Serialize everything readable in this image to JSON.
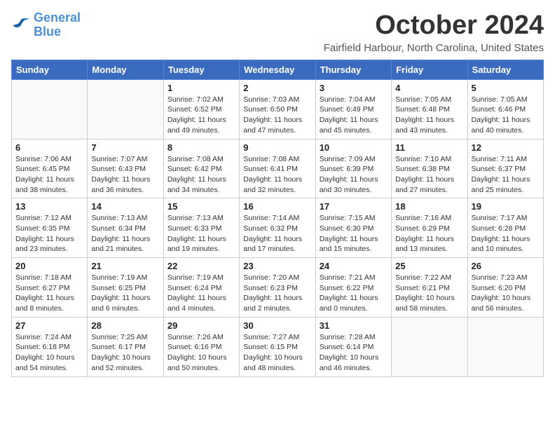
{
  "logo": {
    "general": "General",
    "blue": "Blue"
  },
  "title": "October 2024",
  "location": "Fairfield Harbour, North Carolina, United States",
  "days_of_week": [
    "Sunday",
    "Monday",
    "Tuesday",
    "Wednesday",
    "Thursday",
    "Friday",
    "Saturday"
  ],
  "weeks": [
    [
      {
        "day": "",
        "info": ""
      },
      {
        "day": "",
        "info": ""
      },
      {
        "day": "1",
        "info": "Sunrise: 7:02 AM\nSunset: 6:52 PM\nDaylight: 11 hours and 49 minutes."
      },
      {
        "day": "2",
        "info": "Sunrise: 7:03 AM\nSunset: 6:50 PM\nDaylight: 11 hours and 47 minutes."
      },
      {
        "day": "3",
        "info": "Sunrise: 7:04 AM\nSunset: 6:49 PM\nDaylight: 11 hours and 45 minutes."
      },
      {
        "day": "4",
        "info": "Sunrise: 7:05 AM\nSunset: 6:48 PM\nDaylight: 11 hours and 43 minutes."
      },
      {
        "day": "5",
        "info": "Sunrise: 7:05 AM\nSunset: 6:46 PM\nDaylight: 11 hours and 40 minutes."
      }
    ],
    [
      {
        "day": "6",
        "info": "Sunrise: 7:06 AM\nSunset: 6:45 PM\nDaylight: 11 hours and 38 minutes."
      },
      {
        "day": "7",
        "info": "Sunrise: 7:07 AM\nSunset: 6:43 PM\nDaylight: 11 hours and 36 minutes."
      },
      {
        "day": "8",
        "info": "Sunrise: 7:08 AM\nSunset: 6:42 PM\nDaylight: 11 hours and 34 minutes."
      },
      {
        "day": "9",
        "info": "Sunrise: 7:08 AM\nSunset: 6:41 PM\nDaylight: 11 hours and 32 minutes."
      },
      {
        "day": "10",
        "info": "Sunrise: 7:09 AM\nSunset: 6:39 PM\nDaylight: 11 hours and 30 minutes."
      },
      {
        "day": "11",
        "info": "Sunrise: 7:10 AM\nSunset: 6:38 PM\nDaylight: 11 hours and 27 minutes."
      },
      {
        "day": "12",
        "info": "Sunrise: 7:11 AM\nSunset: 6:37 PM\nDaylight: 11 hours and 25 minutes."
      }
    ],
    [
      {
        "day": "13",
        "info": "Sunrise: 7:12 AM\nSunset: 6:35 PM\nDaylight: 11 hours and 23 minutes."
      },
      {
        "day": "14",
        "info": "Sunrise: 7:13 AM\nSunset: 6:34 PM\nDaylight: 11 hours and 21 minutes."
      },
      {
        "day": "15",
        "info": "Sunrise: 7:13 AM\nSunset: 6:33 PM\nDaylight: 11 hours and 19 minutes."
      },
      {
        "day": "16",
        "info": "Sunrise: 7:14 AM\nSunset: 6:32 PM\nDaylight: 11 hours and 17 minutes."
      },
      {
        "day": "17",
        "info": "Sunrise: 7:15 AM\nSunset: 6:30 PM\nDaylight: 11 hours and 15 minutes."
      },
      {
        "day": "18",
        "info": "Sunrise: 7:16 AM\nSunset: 6:29 PM\nDaylight: 11 hours and 13 minutes."
      },
      {
        "day": "19",
        "info": "Sunrise: 7:17 AM\nSunset: 6:28 PM\nDaylight: 11 hours and 10 minutes."
      }
    ],
    [
      {
        "day": "20",
        "info": "Sunrise: 7:18 AM\nSunset: 6:27 PM\nDaylight: 11 hours and 8 minutes."
      },
      {
        "day": "21",
        "info": "Sunrise: 7:19 AM\nSunset: 6:25 PM\nDaylight: 11 hours and 6 minutes."
      },
      {
        "day": "22",
        "info": "Sunrise: 7:19 AM\nSunset: 6:24 PM\nDaylight: 11 hours and 4 minutes."
      },
      {
        "day": "23",
        "info": "Sunrise: 7:20 AM\nSunset: 6:23 PM\nDaylight: 11 hours and 2 minutes."
      },
      {
        "day": "24",
        "info": "Sunrise: 7:21 AM\nSunset: 6:22 PM\nDaylight: 11 hours and 0 minutes."
      },
      {
        "day": "25",
        "info": "Sunrise: 7:22 AM\nSunset: 6:21 PM\nDaylight: 10 hours and 58 minutes."
      },
      {
        "day": "26",
        "info": "Sunrise: 7:23 AM\nSunset: 6:20 PM\nDaylight: 10 hours and 56 minutes."
      }
    ],
    [
      {
        "day": "27",
        "info": "Sunrise: 7:24 AM\nSunset: 6:18 PM\nDaylight: 10 hours and 54 minutes."
      },
      {
        "day": "28",
        "info": "Sunrise: 7:25 AM\nSunset: 6:17 PM\nDaylight: 10 hours and 52 minutes."
      },
      {
        "day": "29",
        "info": "Sunrise: 7:26 AM\nSunset: 6:16 PM\nDaylight: 10 hours and 50 minutes."
      },
      {
        "day": "30",
        "info": "Sunrise: 7:27 AM\nSunset: 6:15 PM\nDaylight: 10 hours and 48 minutes."
      },
      {
        "day": "31",
        "info": "Sunrise: 7:28 AM\nSunset: 6:14 PM\nDaylight: 10 hours and 46 minutes."
      },
      {
        "day": "",
        "info": ""
      },
      {
        "day": "",
        "info": ""
      }
    ]
  ]
}
